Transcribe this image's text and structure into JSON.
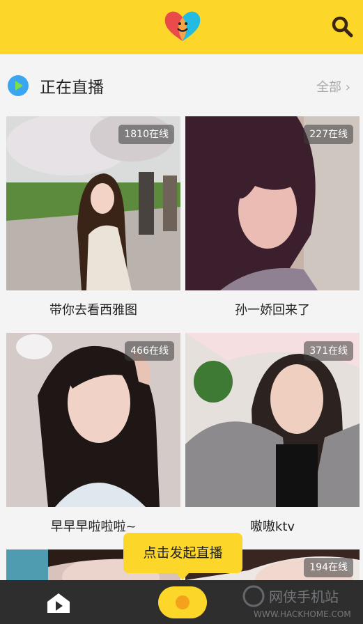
{
  "header": {
    "logo": "heart-face-logo",
    "search_icon": "search-icon"
  },
  "section": {
    "title": "正在直播",
    "see_all": "全部",
    "chevron": "›"
  },
  "streams": [
    {
      "title": "带你去看西雅图",
      "viewers": "1810在线"
    },
    {
      "title": "孙一娇回来了",
      "viewers": "227在线"
    },
    {
      "title": "早早早啦啦啦~",
      "viewers": "466在线"
    },
    {
      "title": "嗷嗷ktv",
      "viewers": "371在线"
    },
    {
      "title": "",
      "viewers": ""
    },
    {
      "title": "",
      "viewers": "194在线"
    }
  ],
  "tooltip": {
    "text": "点击发起直播"
  },
  "bottom_nav": {
    "home_icon": "play-home-icon",
    "live_icon": "live-record-icon"
  },
  "watermark": {
    "main": "网侠手机站",
    "sub": "WWW.HACKHOME.COM"
  },
  "colors": {
    "brand_yellow": "#fcd72a",
    "bar_dark": "#2f2e2e",
    "accent_blue": "#3aa6f2"
  }
}
